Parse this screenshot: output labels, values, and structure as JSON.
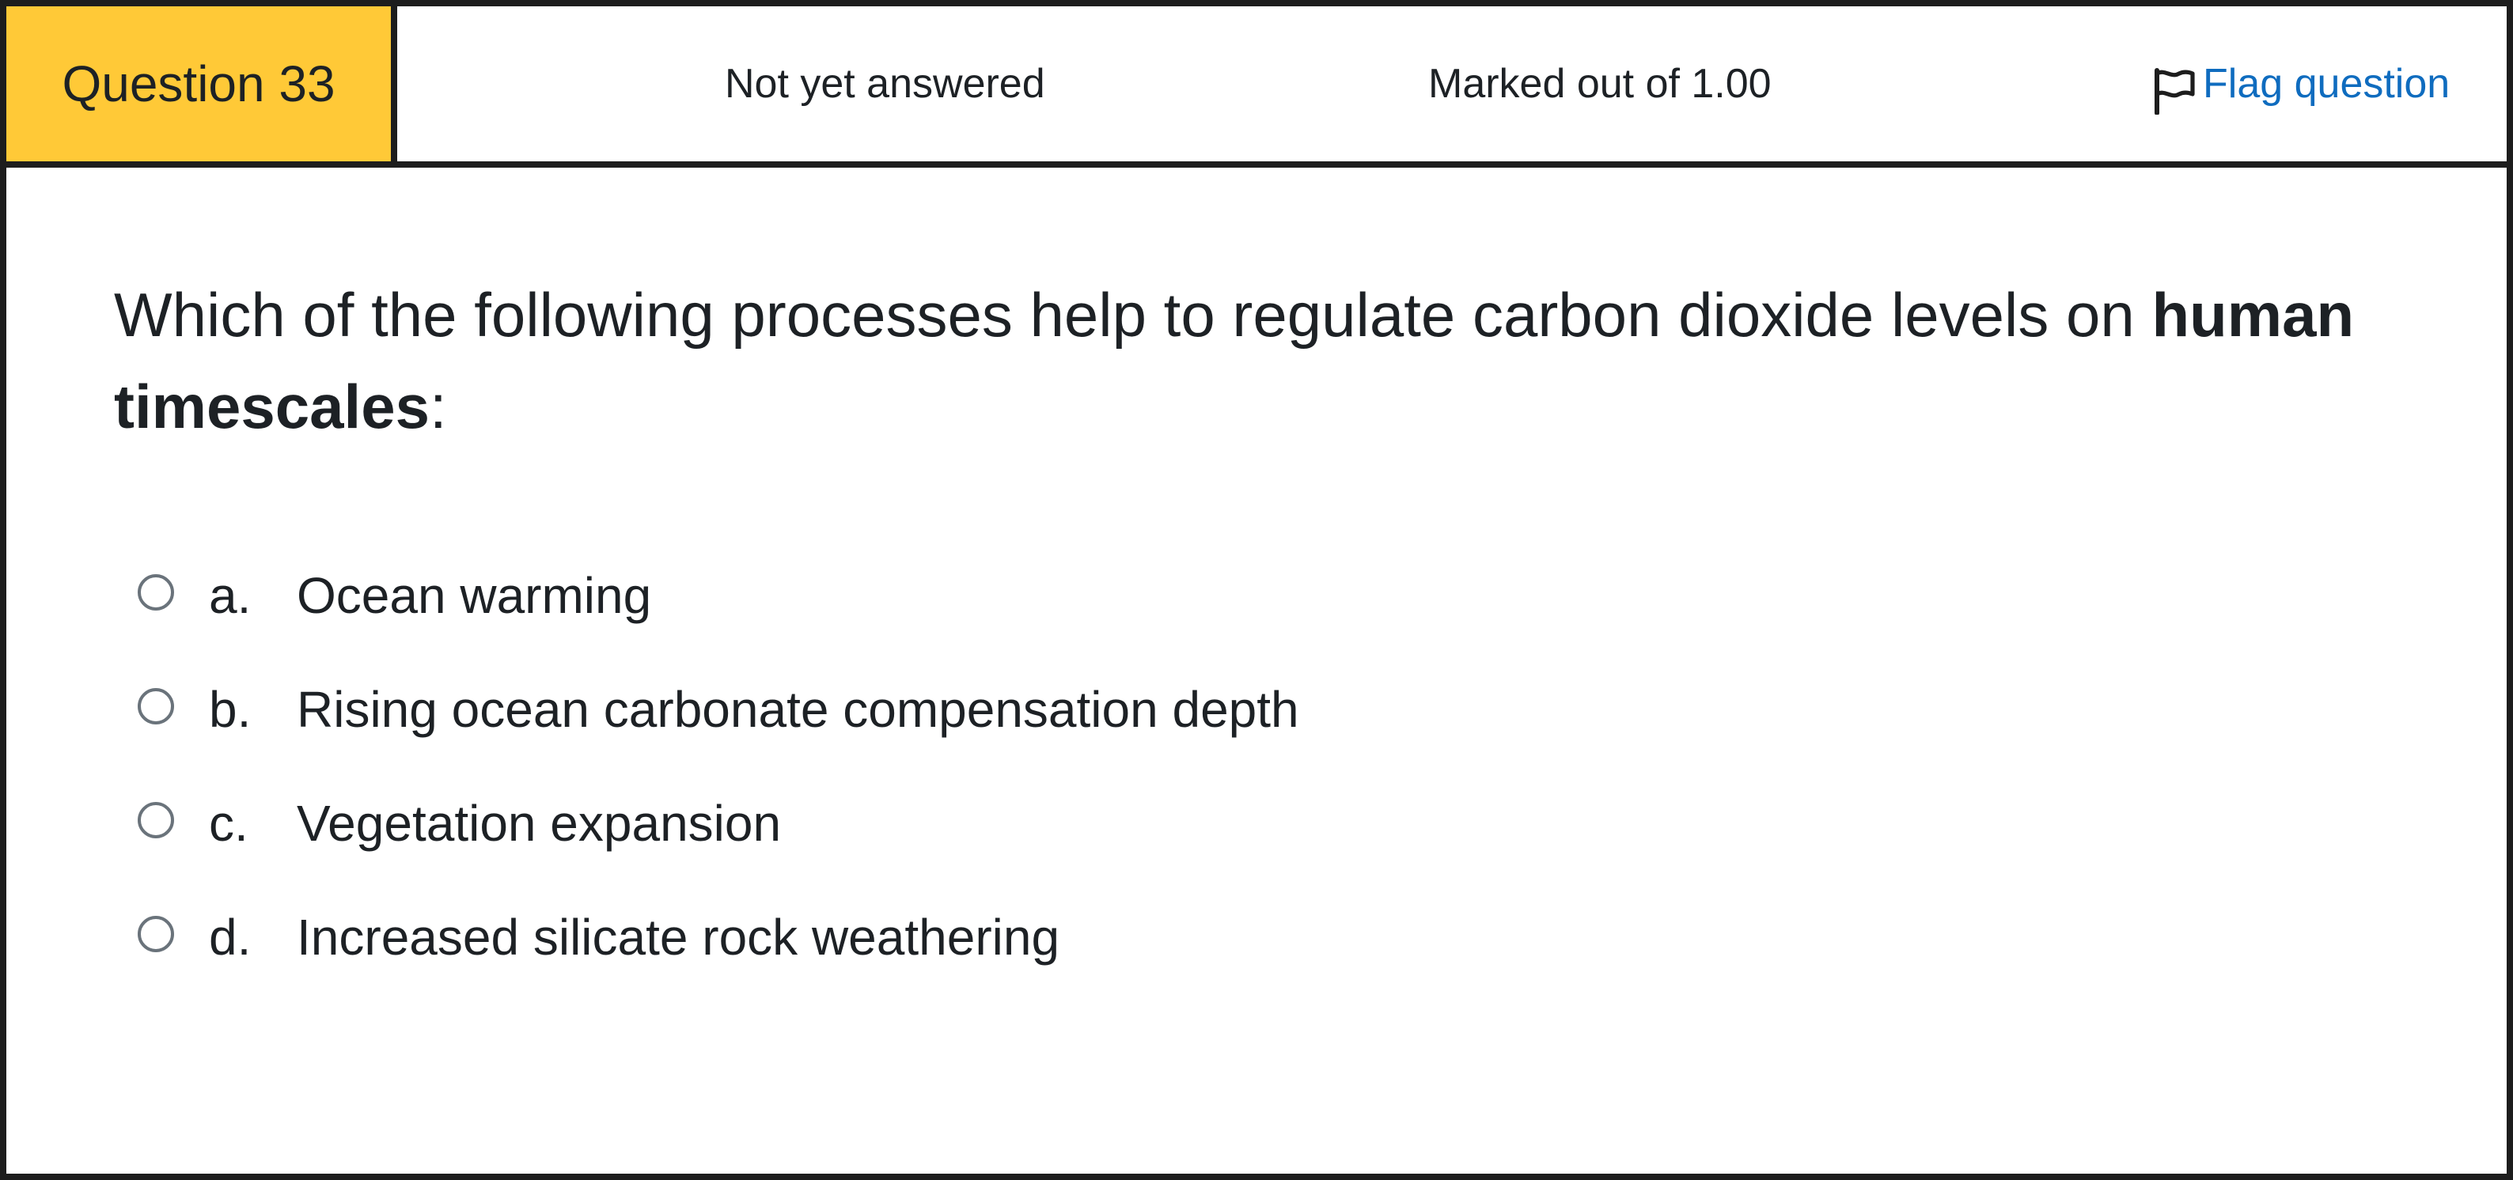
{
  "header": {
    "question_label": "Question 33",
    "state": "Not yet answered",
    "grade": "Marked out of 1.00",
    "flag_label": "Flag question",
    "flag_icon": "flag-outline-icon"
  },
  "question": {
    "text_before": "Which of the following processes help to regulate carbon dioxide levels on ",
    "text_bold": "human timescales",
    "text_after": ":"
  },
  "answers": [
    {
      "letter": "a.",
      "text": "Ocean warming",
      "selected": false
    },
    {
      "letter": "b.",
      "text": "Rising ocean carbonate compensation depth",
      "selected": false
    },
    {
      "letter": "c.",
      "text": "Vegetation expansion",
      "selected": false
    },
    {
      "letter": "d.",
      "text": "Increased silicate rock weathering",
      "selected": false
    }
  ],
  "colors": {
    "question_badge": "#ffc937",
    "link": "#0f6cbf",
    "border": "#1d1d1d",
    "text": "#1d2125"
  }
}
